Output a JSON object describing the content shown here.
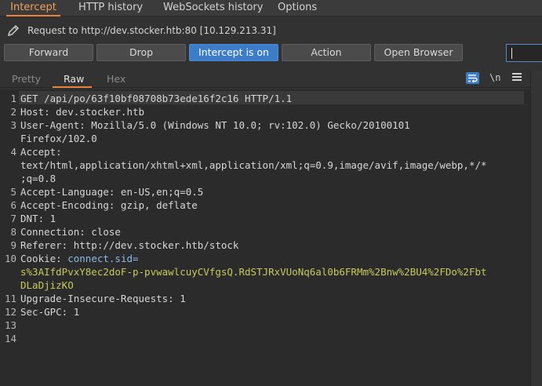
{
  "top_tabs": [
    "Intercept",
    "HTTP history",
    "WebSockets history",
    "Options"
  ],
  "request_info": "Request to http://dev.stocker.htb:80  [10.129.213.31]",
  "buttons": {
    "forward": "Forward",
    "drop": "Drop",
    "intercept": "Intercept is on",
    "action": "Action",
    "open_browser": "Open Browser"
  },
  "sub_tabs": [
    "Pretty",
    "Raw",
    "Hex"
  ],
  "newline_toggle": "\\n",
  "icons": [
    "pencil-icon",
    "word-wrap-icon",
    "newline-icon",
    "menu-icon"
  ],
  "colors": {
    "accent": "#e8823c",
    "primary_button": "#3d7cc9",
    "cookie_value": "#c9c95a"
  },
  "request_lines": [
    {
      "num": "1",
      "text": "GET /api/po/63f10bf08708b73ede16f2c16 HTTP/1.1"
    },
    {
      "num": "2",
      "text": "Host: dev.stocker.htb"
    },
    {
      "num": "3",
      "text": "User-Agent: Mozilla/5.0 (Windows NT 10.0; rv:102.0) Gecko/20100101"
    },
    {
      "num": "",
      "text": "Firefox/102.0"
    },
    {
      "num": "4",
      "text": "Accept:"
    },
    {
      "num": "",
      "text": "text/html,application/xhtml+xml,application/xml;q=0.9,image/avif,image/webp,*/*"
    },
    {
      "num": "",
      "text": ";q=0.8"
    },
    {
      "num": "5",
      "text": "Accept-Language: en-US,en;q=0.5"
    },
    {
      "num": "6",
      "text": "Accept-Encoding: gzip, deflate"
    },
    {
      "num": "7",
      "text": "DNT: 1"
    },
    {
      "num": "8",
      "text": "Connection: close"
    },
    {
      "num": "9",
      "text": "Referer: http://dev.stocker.htb/stock"
    },
    {
      "num": "10",
      "text": "Cookie: "
    },
    {
      "num": "",
      "text": ""
    },
    {
      "num": "",
      "text": ""
    },
    {
      "num": "11",
      "text": "Upgrade-Insecure-Requests: 1"
    },
    {
      "num": "12",
      "text": "Sec-GPC: 1"
    },
    {
      "num": "13",
      "text": ""
    },
    {
      "num": "14",
      "text": ""
    }
  ],
  "cookie": {
    "name": "connect.sid=",
    "value_line1": "s%3AIfdPvxY8ec2doF-p-pvwawlcuyCVfgsQ.RdSTJRxVUoNq6al0b6FRMm%2Bnw%2BU4%2FDo%2Fbt",
    "value_line2": "DLaDjizKO"
  }
}
